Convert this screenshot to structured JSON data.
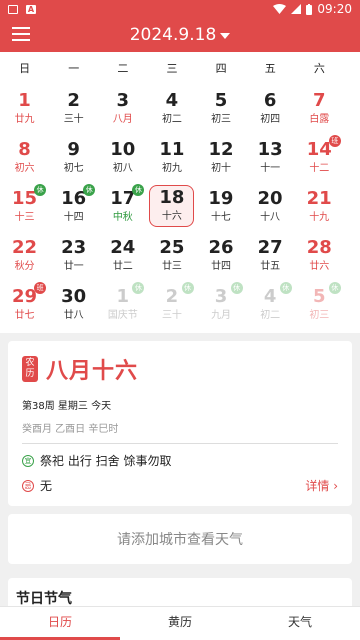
{
  "status_bar": {
    "time": "09:20",
    "icons": [
      "image-icon",
      "a-icon",
      "wifi-icon",
      "signal-icon",
      "battery-icon"
    ]
  },
  "app_bar": {
    "title": "2024.9.18"
  },
  "weekdays": [
    "日",
    "一",
    "二",
    "三",
    "四",
    "五",
    "六"
  ],
  "days": [
    {
      "n": "1",
      "l": "廿九",
      "red": true
    },
    {
      "n": "2",
      "l": "三十"
    },
    {
      "n": "3",
      "l": "八月",
      "lr": true
    },
    {
      "n": "4",
      "l": "初二"
    },
    {
      "n": "5",
      "l": "初三"
    },
    {
      "n": "6",
      "l": "初四"
    },
    {
      "n": "7",
      "l": "白露",
      "red": true
    },
    {
      "n": "8",
      "l": "初六",
      "red": true
    },
    {
      "n": "9",
      "l": "初七"
    },
    {
      "n": "10",
      "l": "初八"
    },
    {
      "n": "11",
      "l": "初九"
    },
    {
      "n": "12",
      "l": "初十"
    },
    {
      "n": "13",
      "l": "十一"
    },
    {
      "n": "14",
      "l": "十二",
      "red": true,
      "badge": "班"
    },
    {
      "n": "15",
      "l": "十三",
      "red": true,
      "badge": "休"
    },
    {
      "n": "16",
      "l": "十四",
      "badge": "休"
    },
    {
      "n": "17",
      "l": "中秋",
      "lg": true,
      "badge": "休"
    },
    {
      "n": "18",
      "l": "十六",
      "selected": true
    },
    {
      "n": "19",
      "l": "十七"
    },
    {
      "n": "20",
      "l": "十八"
    },
    {
      "n": "21",
      "l": "十九",
      "red": true
    },
    {
      "n": "22",
      "l": "秋分",
      "red": true
    },
    {
      "n": "23",
      "l": "廿一"
    },
    {
      "n": "24",
      "l": "廿二"
    },
    {
      "n": "25",
      "l": "廿三"
    },
    {
      "n": "26",
      "l": "廿四"
    },
    {
      "n": "27",
      "l": "廿五"
    },
    {
      "n": "28",
      "l": "廿六",
      "red": true
    },
    {
      "n": "29",
      "l": "廿七",
      "red": true,
      "badge": "班"
    },
    {
      "n": "30",
      "l": "廿八"
    },
    {
      "n": "1",
      "l": "国庆节",
      "faded": true,
      "lg": true,
      "badge": "休"
    },
    {
      "n": "2",
      "l": "三十",
      "faded": true,
      "badge": "休"
    },
    {
      "n": "3",
      "l": "九月",
      "faded": true,
      "lr": true,
      "badge": "休"
    },
    {
      "n": "4",
      "l": "初二",
      "faded": true,
      "badge": "休"
    },
    {
      "n": "5",
      "l": "初三",
      "faded": true,
      "red": true,
      "badge": "休"
    }
  ],
  "lunar_card": {
    "tag_top": "农",
    "tag_bottom": "历",
    "lunar_date": "八月十六",
    "week_line": "第38周 星期三 今天",
    "ganzhi": "癸酉月 乙酉日 辛巳时",
    "yi_mark": "宜",
    "yi": "祭祀 出行 扫舍 馀事勿取",
    "ji_mark": "忌",
    "ji": "无",
    "detail": "详情 ›"
  },
  "weather_card": {
    "text": "请添加城市查看天气"
  },
  "festival_card": {
    "title": "节日节气"
  },
  "tabs": [
    {
      "label": "日历",
      "active": true
    },
    {
      "label": "黄历"
    },
    {
      "label": "天气"
    }
  ],
  "colors": {
    "accent": "#e04a4a",
    "rest": "#3aa24a"
  }
}
